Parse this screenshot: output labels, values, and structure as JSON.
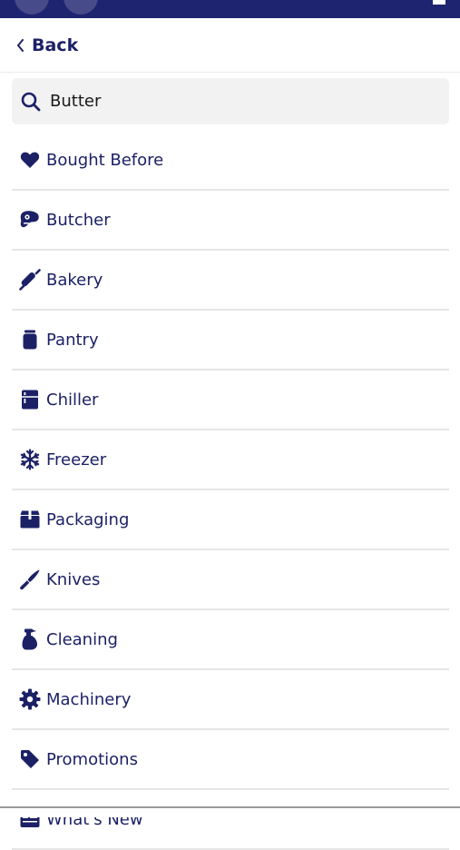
{
  "header": {
    "back_label": "Back"
  },
  "search": {
    "value": "Butter",
    "placeholder": ""
  },
  "categories": [
    {
      "label": "Bought Before",
      "icon": "heart-icon"
    },
    {
      "label": "Butcher",
      "icon": "meat-icon"
    },
    {
      "label": "Bakery",
      "icon": "rolling-pin-icon"
    },
    {
      "label": "Pantry",
      "icon": "jar-icon"
    },
    {
      "label": "Chiller",
      "icon": "fridge-icon"
    },
    {
      "label": "Freezer",
      "icon": "snowflake-icon"
    },
    {
      "label": "Packaging",
      "icon": "box-icon"
    },
    {
      "label": "Knives",
      "icon": "knife-icon"
    },
    {
      "label": "Cleaning",
      "icon": "spray-bottle-icon"
    },
    {
      "label": "Machinery",
      "icon": "gear-icon"
    },
    {
      "label": "Promotions",
      "icon": "tag-icon"
    },
    {
      "label": "What's New",
      "icon": "newspaper-icon"
    }
  ],
  "colors": {
    "brand_navy": "#1f2470",
    "text_navy": "#1c2166",
    "search_bg": "#f2f2f2",
    "divider": "#e6e6e6"
  }
}
